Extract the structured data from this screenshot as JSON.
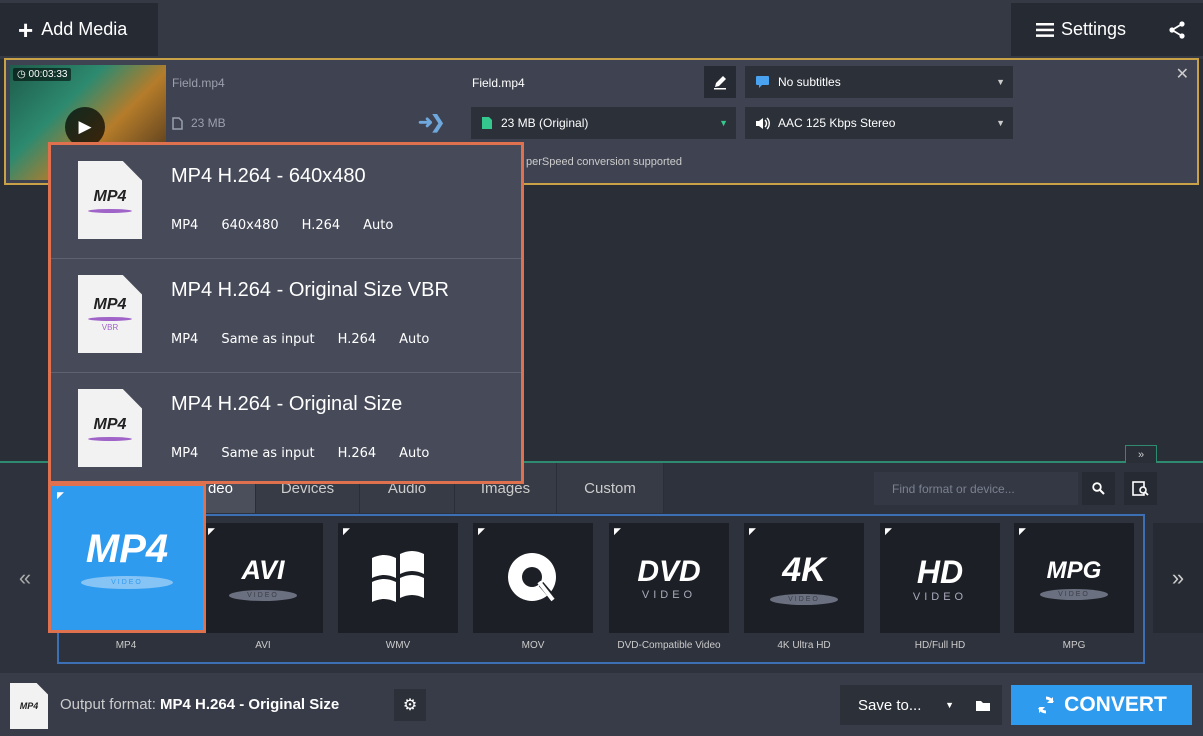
{
  "toolbar": {
    "add_media_label": "Add Media",
    "settings_label": "Settings"
  },
  "file": {
    "duration": "00:03:33",
    "source_name": "Field.mp4",
    "source_size": "23 MB",
    "output_name": "Field.mp4",
    "output_size": "23 MB (Original)",
    "subtitles": "No subtitles",
    "audio": "AAC 125 Kbps Stereo",
    "note": "perSpeed conversion supported"
  },
  "presets": [
    {
      "title": "MP4 H.264 - 640x480",
      "meta": [
        "MP4",
        "640x480",
        "H.264",
        "Auto"
      ],
      "badge": ""
    },
    {
      "title": "MP4 H.264 - Original Size VBR",
      "meta": [
        "MP4",
        "Same as input",
        "H.264",
        "Auto"
      ],
      "badge": "VBR"
    },
    {
      "title": "MP4 H.264 - Original Size",
      "meta": [
        "MP4",
        "Same as input",
        "H.264",
        "Auto"
      ],
      "badge": ""
    }
  ],
  "tabs": [
    "deo",
    "Devices",
    "Audio",
    "Images",
    "Custom"
  ],
  "search": {
    "placeholder": "Find format or device..."
  },
  "formats": [
    {
      "logo": "MP4",
      "label": "MP4",
      "band": "VIDEO"
    },
    {
      "logo": "AVI",
      "label": "AVI",
      "band": "VIDEO"
    },
    {
      "logo": "",
      "label": "WMV",
      "band": ""
    },
    {
      "logo": "",
      "label": "MOV",
      "band": ""
    },
    {
      "logo": "DVD",
      "label": "DVD-Compatible Video",
      "band": "VIDEO"
    },
    {
      "logo": "4K",
      "label": "4K Ultra HD",
      "band": "VIDEO"
    },
    {
      "logo": "HD",
      "label": "HD/Full HD",
      "band": "VIDEO"
    },
    {
      "logo": "MPG",
      "label": "MPG",
      "band": "VIDEO"
    }
  ],
  "footer": {
    "output_prefix": "Output format:",
    "output_value": "MP4 H.264 - Original Size",
    "save_label": "Save to...",
    "convert_label": "CONVERT",
    "icon_text": "MP4"
  },
  "colors": {
    "accent": "#2f9bef",
    "highlight": "#e0714f",
    "file_border": "#c9a248"
  }
}
